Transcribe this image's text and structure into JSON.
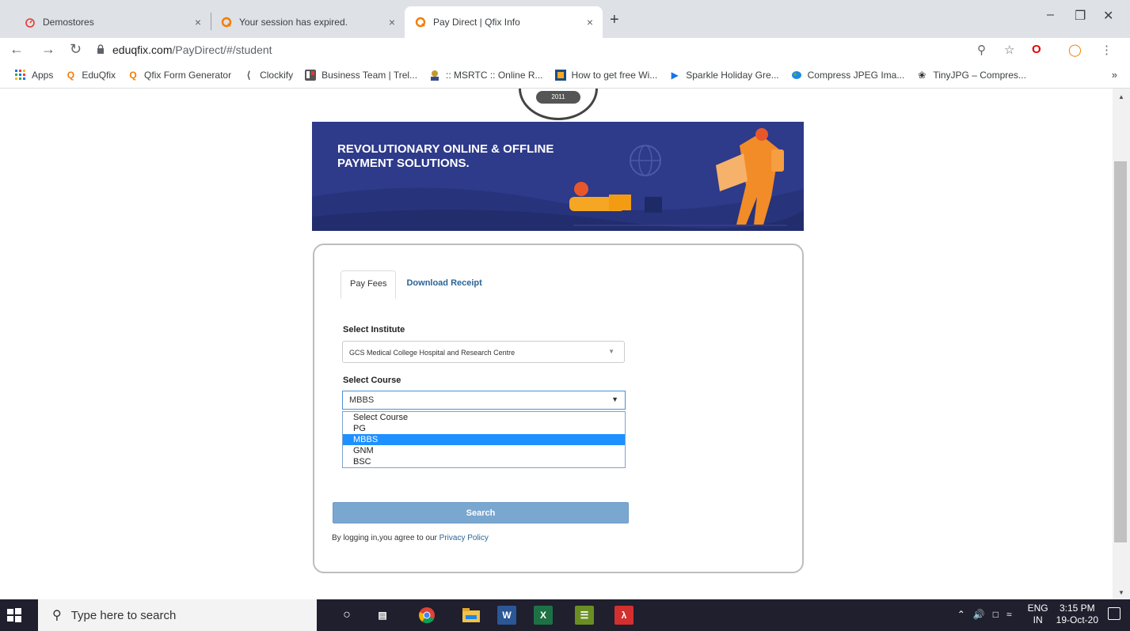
{
  "browser": {
    "tabs": [
      {
        "title": "Demostores",
        "icon": "timer-icon",
        "active": false
      },
      {
        "title": "Your session has expired.",
        "icon": "qfix-icon",
        "active": false
      },
      {
        "title": "Pay Direct | Qfix Info",
        "icon": "qfix-icon",
        "active": true
      }
    ],
    "new_tab": "+",
    "close_glyph": "×",
    "url": {
      "host": "eduqfix.com",
      "path": "/PayDirect/#/student"
    },
    "bookmarks": [
      {
        "label": "Apps",
        "icon": "apps-grid-icon"
      },
      {
        "label": "EduQfix",
        "icon": "qfix-icon"
      },
      {
        "label": "Qfix Form Generator",
        "icon": "qfix-icon"
      },
      {
        "label": "Clockify",
        "icon": "clockify-icon"
      },
      {
        "label": "Business Team | Trel...",
        "icon": "trello-icon"
      },
      {
        "label": ":: MSRTC :: Online R...",
        "icon": "msrtc-icon"
      },
      {
        "label": "How to get free Wi...",
        "icon": "page-icon"
      },
      {
        "label": "Sparkle Holiday Gre...",
        "icon": "play-icon"
      },
      {
        "label": "Compress JPEG Ima...",
        "icon": "compress-icon"
      },
      {
        "label": "TinyJPG – Compres...",
        "icon": "panda-icon"
      }
    ],
    "bookmarks_more": "»"
  },
  "page": {
    "logo_year": "2011",
    "banner_title": "REVOLUTIONARY ONLINE & OFFLINE PAYMENT SOLUTIONS.",
    "tabs": {
      "pay_fees": "Pay Fees",
      "download_receipt": "Download Receipt"
    },
    "institute": {
      "label": "Select Institute",
      "value": "GCS Medical College Hospital and Research Centre"
    },
    "course": {
      "label": "Select Course",
      "value": "MBBS",
      "options": [
        "Select Course",
        "PG",
        "MBBS",
        "GNM",
        "BSC"
      ],
      "selected_index": 2
    },
    "search_label": "Search",
    "agree_text": "By logging in,you agree to our",
    "privacy_link": "Privacy Policy"
  },
  "taskbar": {
    "search_placeholder": "Type here to search",
    "lang": "ENG",
    "region": "IN",
    "time": "3:15 PM",
    "date": "19-Oct-20"
  },
  "colors": {
    "banner": "#2e3a8a",
    "accent": "#1e90ff",
    "search_button": "#7aa7cf",
    "link": "#2a6496"
  }
}
